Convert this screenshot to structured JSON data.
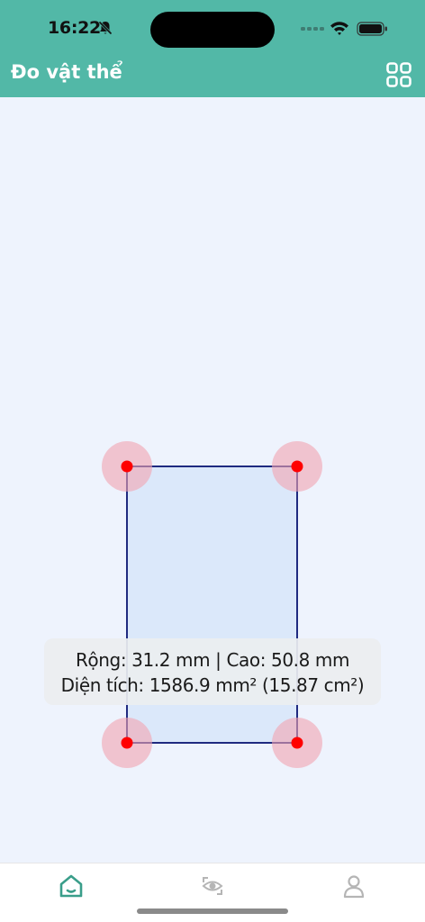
{
  "status_bar": {
    "time": "16:22",
    "icons": [
      "bell-slash-icon",
      "cellular-signal-icon",
      "wifi-icon",
      "battery-icon"
    ]
  },
  "header": {
    "title": "Đo vật thể",
    "menu_icon": "grid-icon"
  },
  "measurement": {
    "width_mm": 31.2,
    "height_mm": 50.8,
    "dimensions_text": "Rộng: 31.2 mm | Cao: 50.8 mm",
    "area_text": "Diện tích: 1586.9 mm² (15.87 cm²)"
  },
  "colors": {
    "header_bg": "#52b8a7",
    "canvas_bg": "#eef3fd",
    "rect_fill": "#dbe8fa",
    "rect_stroke": "#1f2a80",
    "handle": "#ff0000",
    "handle_halo": "#f2a3b0",
    "tab_active": "#3a9e8a",
    "tab_inactive": "#b5b5b5"
  },
  "tab_bar": {
    "tabs": [
      {
        "icon": "home-icon",
        "active": true
      },
      {
        "icon": "scan-icon",
        "active": false
      },
      {
        "icon": "user-icon",
        "active": false
      }
    ]
  }
}
